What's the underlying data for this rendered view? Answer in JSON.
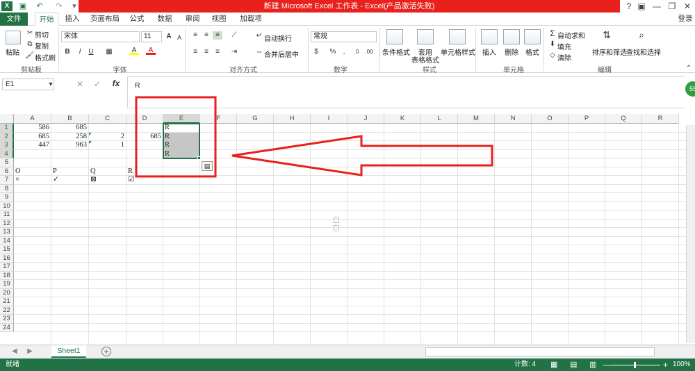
{
  "title_bar": {
    "title": "新建 Microsoft Excel 工作表 - Excel(产品激活失败)",
    "login": "登录"
  },
  "quick_access": {
    "icons": [
      "excel-icon",
      "save-icon",
      "undo-icon",
      "redo-icon",
      "customize-icon"
    ]
  },
  "window": {
    "help": "?",
    "ribbon_opts": "▣",
    "minimize": "—",
    "restore": "❐",
    "close": "✕"
  },
  "tabs": [
    "文件",
    "开始",
    "插入",
    "页面布局",
    "公式",
    "数据",
    "审阅",
    "视图",
    "加载项"
  ],
  "ribbon": {
    "clipboard": {
      "paste": "粘贴",
      "cut": "剪切",
      "copy": "复制",
      "format_painter": "格式刷",
      "label": "剪贴板"
    },
    "font": {
      "name": "宋体",
      "size": "11",
      "bold": "B",
      "italic": "I",
      "underline": "U",
      "label": "字体",
      "grow": "A",
      "shrink": "A",
      "fill": "A",
      "color": "A"
    },
    "alignment": {
      "wrap": "自动换行",
      "merge": "合并后居中",
      "label": "对齐方式"
    },
    "number": {
      "format": "常规",
      "percent": "%",
      "comma": ",",
      "label": "数字"
    },
    "styles": {
      "conditional": "条件格式",
      "table": "套用",
      "table2": "表格格式",
      "cell_styles": "单元格样式",
      "label": "样式"
    },
    "cells": {
      "insert": "插入",
      "delete": "删除",
      "format": "格式",
      "label": "单元格"
    },
    "editing": {
      "autosum": "自动求和",
      "fill": "填充",
      "clear": "清除",
      "sort": "排序和筛选",
      "find": "查找和选择",
      "label": "编辑"
    }
  },
  "formula_bar": {
    "name_box": "E1",
    "content": "R",
    "fx": "fx"
  },
  "columns": [
    "A",
    "B",
    "C",
    "D",
    "E",
    "F",
    "G",
    "H",
    "I",
    "J",
    "K",
    "L",
    "M",
    "N",
    "O",
    "P",
    "Q",
    "R"
  ],
  "rows": [
    "1",
    "2",
    "3",
    "4",
    "5",
    "6",
    "7",
    "8",
    "9",
    "10",
    "11",
    "12",
    "13",
    "14",
    "15",
    "16",
    "17",
    "18",
    "19",
    "20",
    "21",
    "22",
    "23",
    "24"
  ],
  "cells": {
    "A1": "586",
    "B1": "685",
    "A2": "685",
    "B2": "258",
    "C2": "2",
    "D2": "685",
    "A3": "447",
    "B3": "963",
    "C3": "1",
    "E1": "R",
    "E2": "R",
    "E3": "R",
    "E4": "R",
    "A6": "O",
    "B6": "P",
    "C6": "Q",
    "D6": "R",
    "A7": "×",
    "B7": "✓",
    "C7": "⊠",
    "D7": "☑"
  },
  "sheet_tabs": [
    "Sheet1"
  ],
  "status": {
    "ready": "就绪",
    "count": "计数: 4",
    "zoom": "100%"
  },
  "badge": "55",
  "colors": {
    "excel_green": "#217346",
    "title_red": "#e8211c",
    "annotation_red": "#e8211c"
  }
}
